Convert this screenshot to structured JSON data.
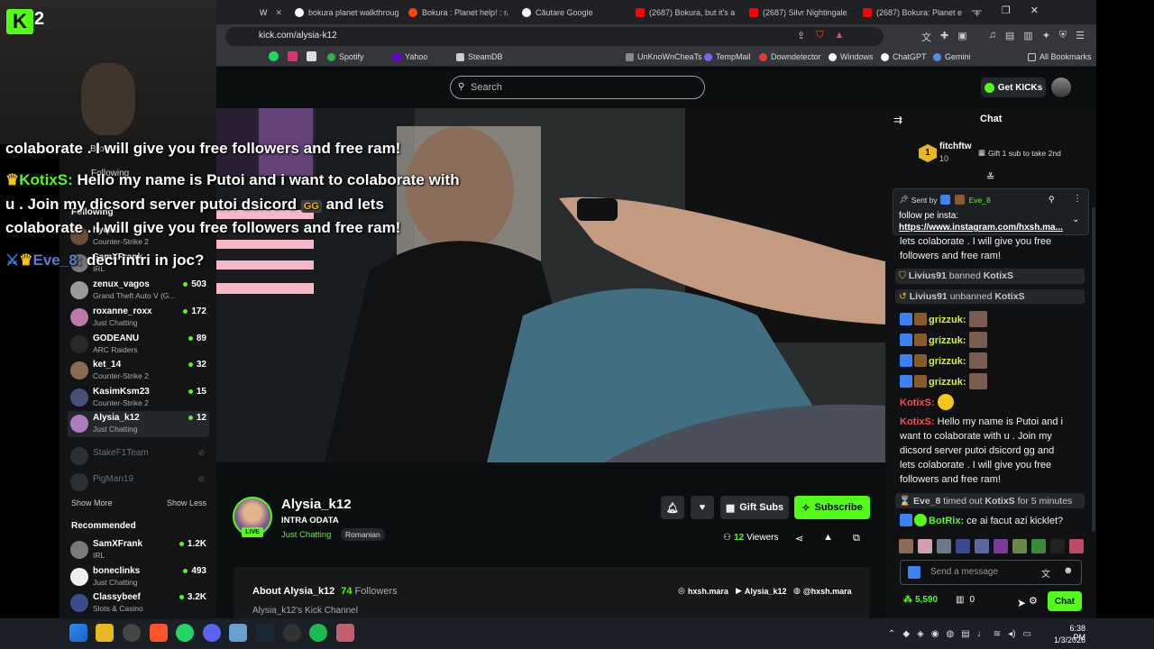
{
  "browser": {
    "tabs": [
      {
        "label": "bokura planet walkthroug"
      },
      {
        "label": "Bokura : Planet help! : r/"
      },
      {
        "label": "Căutare Google"
      },
      {
        "label": "(2687) Bokura, but it's a w"
      },
      {
        "label": "(2687) Silvr Nightingale -"
      },
      {
        "label": "(2687) Bokura: Planet ep"
      }
    ],
    "url": "kick.com/alysia-k12",
    "bookmarks": [
      "Spotify",
      "Yahoo",
      "SteamDB",
      "UnKnoWnCheaTs",
      "TempMail",
      "Downdetector",
      "Windows",
      "ChatGPT",
      "Gemini"
    ],
    "all_bookmarks": "All Bookmarks",
    "new_tab": "+"
  },
  "header": {
    "search_placeholder": "Search",
    "get_kicks": "Get KICKs"
  },
  "sidebar": {
    "browse": "Browse",
    "following_nav": "Following",
    "following_title": "Following",
    "channels": [
      {
        "name": "hyqnu",
        "category": "Counter-Strike 2",
        "viewers": "",
        "color": "#6b4e3a"
      },
      {
        "name": "SamXFrank",
        "category": "IRL",
        "viewers": "",
        "color": "#7a7a7a"
      },
      {
        "name": "zenux_vagos",
        "category": "Grand Theft Auto V (G...",
        "viewers": "503",
        "color": "#9a9a9a"
      },
      {
        "name": "roxanne_roxx",
        "category": "Just Chatting",
        "viewers": "172",
        "color": "#c07aa8"
      },
      {
        "name": "GODEANU",
        "category": "ARC Raiders",
        "viewers": "89",
        "color": "#2a2a2a"
      },
      {
        "name": "ket_14",
        "category": "Counter-Strike 2",
        "viewers": "32",
        "color": "#8a6d50"
      },
      {
        "name": "KasimKsm23",
        "category": "Counter-Strike 2",
        "viewers": "15",
        "color": "#4a4f7a"
      },
      {
        "name": "Alysia_k12",
        "category": "Just Chatting",
        "viewers": "12",
        "color": "#b07ac0"
      }
    ],
    "offline": [
      {
        "name": "StakeF1Team"
      },
      {
        "name": "PigMan19"
      }
    ],
    "show_more": "Show More",
    "show_less": "Show Less",
    "recommended_title": "Recommended",
    "recommended": [
      {
        "name": "SamXFrank",
        "category": "IRL",
        "viewers": "1.2K",
        "color": "#7a7a7a"
      },
      {
        "name": "boneclinks",
        "category": "Just Chatting",
        "viewers": "493",
        "color": "#eee"
      },
      {
        "name": "Classybeef",
        "category": "Slots & Casino",
        "viewers": "3.2K",
        "color": "#3a4f8a"
      }
    ]
  },
  "overlay": {
    "line1": "colaborate . I will give you free followers and free ram!",
    "line2_user": "KotixS:",
    "line2_text": " Hello my name is Putoi and i want to colaborate with",
    "line3": "u . Join my dicsord server putoi dsicord",
    "line3_end": " and lets",
    "line4": "colaborate . I will give you free followers and free ram!",
    "line5_user": "Eve_8:",
    "line5_text": " deci intri in joc?",
    "emote": "GG"
  },
  "stream": {
    "channel": "Alysia_k12",
    "title": "INTRA ODATA",
    "category": "Just Chatting",
    "language": "Romanian",
    "live_badge": "LIVE",
    "viewers": "12",
    "viewers_label": "Viewers",
    "gift_subs": "Gift Subs",
    "subscribe": "Subscribe",
    "about_title": "About Alysia_k12",
    "followers_count": "74",
    "followers_label": "Followers",
    "about_desc": "Alysia_k12's Kick Channel",
    "socials": [
      "hxsh.mara",
      "Alysia_k12",
      "@hxsh.mara"
    ]
  },
  "chat": {
    "title": "Chat",
    "top_gifter": {
      "rank": "1",
      "name": "fitchftw",
      "count": "10",
      "gift_prompt": "Gift 1 sub to take 2nd"
    },
    "pinned": {
      "sent_by": "Sent by",
      "user": "Eve_8",
      "text": "follow pe insta:",
      "link": "https://www.instagram.com/hxsh.ma..."
    },
    "messages": [
      {
        "type": "cont",
        "text": "lets colaborate . I will give you free followers and free ram!"
      },
      {
        "type": "mod",
        "actor": "Livius91",
        "action": "banned",
        "target": "KotixS"
      },
      {
        "type": "mod",
        "actor": "Livius91",
        "action": "unbanned",
        "target": "KotixS"
      },
      {
        "type": "msg",
        "user": "grizzuk:",
        "text": ""
      },
      {
        "type": "msg",
        "user": "grizzuk:",
        "text": ""
      },
      {
        "type": "msg",
        "user": "grizzuk:",
        "text": ""
      },
      {
        "type": "msg",
        "user": "grizzuk:",
        "text": ""
      },
      {
        "type": "msg",
        "user": "KotixS:",
        "text": ""
      },
      {
        "type": "msg",
        "user": "KotixS:",
        "text": "Hello my name is Putoi and i want to colaborate with u . Join my dicsord server putoi dsicord gg and lets colaborate . I will give you free followers and free ram!"
      },
      {
        "type": "mod",
        "actor": "Eve_8",
        "action": "timed out",
        "target": "KotixS",
        "suffix": "for 5 minutes"
      },
      {
        "type": "msg",
        "user": "BotRix:",
        "text": "ce ai facut azi kicklet?"
      }
    ],
    "input_placeholder": "Send a message",
    "points": "5,590",
    "bag_count": "0",
    "chat_button": "Chat"
  },
  "taskbar": {
    "time": "6:38 PM",
    "date": "1/3/2026"
  },
  "kick_logo": "2"
}
